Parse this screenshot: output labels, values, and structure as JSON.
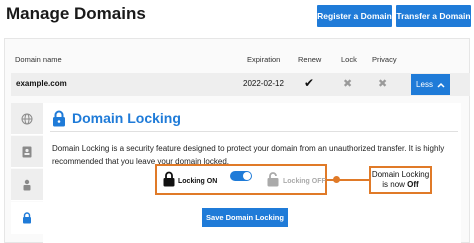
{
  "header": {
    "title": "Manage Domains",
    "register_label": "Register a Domain",
    "transfer_label": "Transfer a Domain"
  },
  "table": {
    "columns": [
      "Domain name",
      "Expiration",
      "Renew",
      "Lock",
      "Privacy"
    ],
    "rows": [
      {
        "domain": "example.com",
        "expiration": "2022-02-12",
        "renew": "✔",
        "lock": "✖",
        "privacy": "✖"
      }
    ],
    "less_label": "Less"
  },
  "sidebar": {
    "tabs": [
      "globe-icon",
      "contact-card-icon",
      "person-lock-icon",
      "lock-icon"
    ],
    "active": 3
  },
  "locking": {
    "title": "Domain Locking",
    "description": "Domain Locking is a security feature designed to protect your domain from an unauthorized transfer. It is highly recommended that you leave your domain locked.",
    "on_label": "Locking ON",
    "off_label": "Locking OFF",
    "save_label": "Save Domain Locking",
    "callout_text": "Domain Locking is now",
    "callout_state": "Off"
  },
  "colors": {
    "accent": "#1f7bd8",
    "highlight": "#e07a28"
  }
}
